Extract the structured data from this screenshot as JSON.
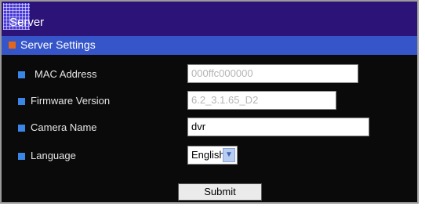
{
  "header": {
    "title": "Server"
  },
  "section": {
    "title": "Server Settings"
  },
  "fields": {
    "mac": {
      "label": "MAC Address",
      "value": "000ffc000000"
    },
    "firmware": {
      "label": "Firmware Version",
      "value": "6.2_3.1.65_D2"
    },
    "camera_name": {
      "label": "Camera Name",
      "value": "dvr"
    },
    "language": {
      "label": "Language",
      "value": "English"
    }
  },
  "actions": {
    "submit_label": "Submit"
  },
  "icons": {
    "title_logo": "grid-logo-icon",
    "section": "square-bullet-icon",
    "row_bullet": "square-bullet-icon",
    "dropdown": "chevron-down-icon"
  },
  "colors": {
    "title_bar": "#2c1378",
    "section_bar": "#3555c9",
    "background": "#0a0a0a",
    "section_icon": "#e2661c",
    "row_bullet": "#3a86e6"
  }
}
